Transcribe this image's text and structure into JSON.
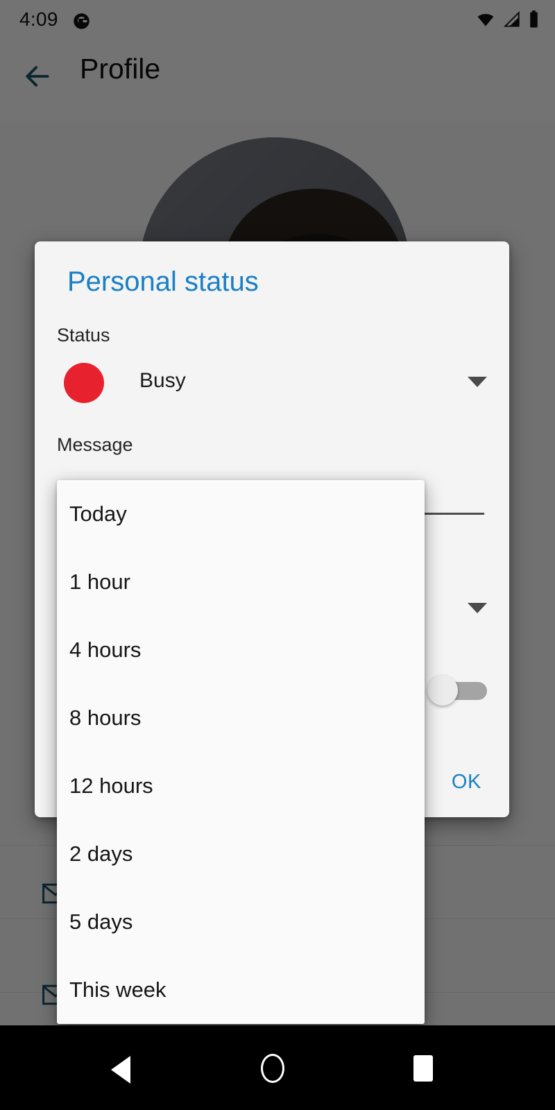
{
  "statusbar": {
    "time": "4:09",
    "app_icon": "g-circle-icon",
    "icons": [
      "wifi-icon",
      "cellular-signal-icon",
      "battery-icon"
    ]
  },
  "appbar": {
    "back_icon": "back-arrow-icon",
    "title": "Profile"
  },
  "background": {
    "avatar_alt": "profile-photo",
    "list_icons": [
      "mail-icon",
      "mail-icon"
    ]
  },
  "dialog": {
    "title": "Personal status",
    "status": {
      "label": "Status",
      "value": "Busy",
      "dot_color": "#e8212e",
      "caret": "chevron-down-icon"
    },
    "message": {
      "label": "Message",
      "value": "",
      "placeholder": ""
    },
    "until": {
      "label": "",
      "value": "",
      "caret": "chevron-down-icon"
    },
    "toggle": {
      "label": "",
      "state": "off"
    },
    "ok_label": "OK"
  },
  "dropdown": {
    "items": [
      {
        "label": "Today"
      },
      {
        "label": "1 hour"
      },
      {
        "label": "4 hours"
      },
      {
        "label": "8 hours"
      },
      {
        "label": "12 hours"
      },
      {
        "label": "2 days"
      },
      {
        "label": "5 days"
      },
      {
        "label": "This week"
      }
    ]
  },
  "navbar": {
    "back": "nav-back-icon",
    "home": "nav-home-icon",
    "recents": "nav-recents-icon"
  },
  "colors": {
    "accent_blue": "#1a80c4",
    "status_red": "#e8212e",
    "appbar_icon": "#19536b"
  }
}
